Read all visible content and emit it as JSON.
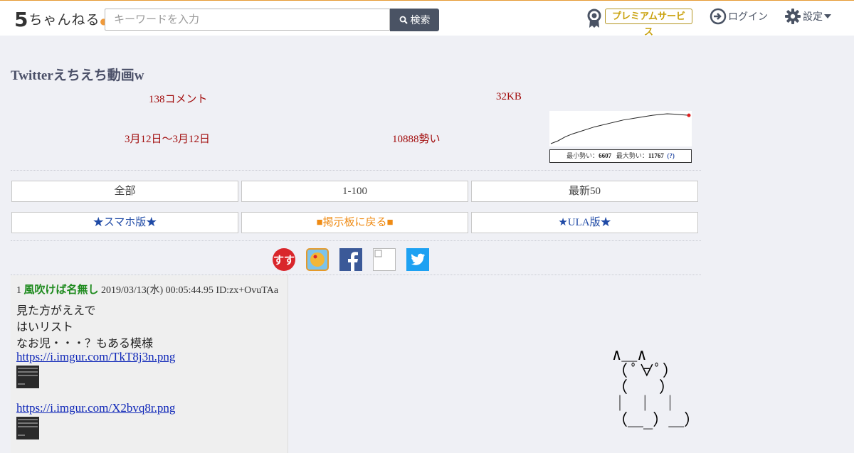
{
  "header": {
    "logo_number": "5",
    "logo_text": "ちゃんねる",
    "search_placeholder": "キーワードを入力",
    "search_button": "検索",
    "premium": "プレミアムサービス",
    "login": "ログイン",
    "settings": "設定"
  },
  "thread": {
    "title": "Twitterえちえち動画w",
    "comments": "138コメント",
    "size": "32KB",
    "date_range": "3月12日〜3月12日",
    "momentum": "10888勢い",
    "chart_caption": {
      "min_label": "最小勢い：",
      "min_value": "6607",
      "max_label": "最大勢い：",
      "max_value": "11767",
      "help": "(?)"
    }
  },
  "nav": {
    "row1": [
      "全部",
      "1-100",
      "最新50"
    ],
    "row2": [
      "★スマホ版★",
      "■掲示板に戻る■",
      "★ULA版★"
    ]
  },
  "share_icons": [
    "matome-icon",
    "bookmark-icon",
    "facebook-icon",
    "broken-image-icon",
    "twitter-icon"
  ],
  "post": {
    "number": "1",
    "name": "風吹けば名無し",
    "datetime": "2019/03/13(水) 00:05:44.95",
    "id": "ID:zx+OvuTAa",
    "lines": [
      "見た方がええで",
      "はいリスト",
      "なお児・・・？もある模様"
    ],
    "link1": "https://i.imgur.com/TkT8j3n.png",
    "link2": "https://i.imgur.com/X2bvq8r.png"
  },
  "ascii_art": "∧＿∧\n（ ﾟ∀ﾟ）\n（　　）\n｜ ｜ ｜\n（＿_）＿）",
  "colors": {
    "accent_orange": "#e69a34",
    "meta_red": "#a20d0d",
    "name_green": "#1d8a1d",
    "link_blue": "#0f27b8"
  },
  "chart_data": {
    "type": "line",
    "title": "",
    "series": [
      {
        "values": [
          6607,
          7100,
          7800,
          8300,
          8700,
          9100,
          9500,
          9800,
          10100,
          10400,
          10700,
          10900,
          11100,
          11300,
          11500,
          11650,
          11767,
          11700,
          11600,
          11500
        ]
      }
    ],
    "ylim": [
      6607,
      11767
    ]
  }
}
